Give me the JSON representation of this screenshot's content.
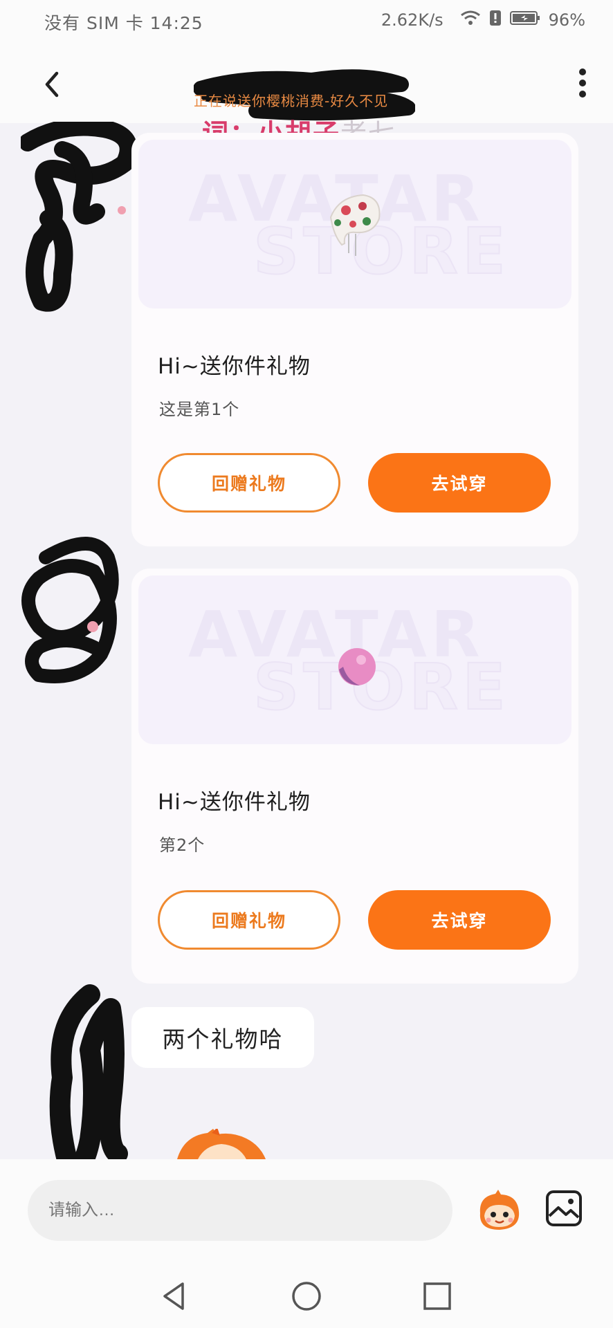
{
  "status_bar": {
    "carrier_time": "没有 SIM 卡 14:25",
    "speed": "2.62K/s",
    "battery": "96%"
  },
  "header": {
    "lyric_line": "正在说送你樱桃消费-好久不见",
    "lyric_credit": "词：小胡子",
    "lyric_credit_extra": "老七"
  },
  "cards": [
    {
      "watermark_1": "AVATAR",
      "watermark_2": "STORE",
      "title": "Hi~送你件礼物",
      "subtitle": "这是第1个",
      "return_gift_label": "回赠礼物",
      "try_on_label": "去试穿"
    },
    {
      "watermark_1": "AVATAR",
      "watermark_2": "STORE",
      "title": "Hi~送你件礼物",
      "subtitle": "第2个",
      "return_gift_label": "回赠礼物",
      "try_on_label": "去试穿"
    }
  ],
  "message": {
    "text": "两个礼物哈"
  },
  "input_bar": {
    "placeholder": "请输入…"
  },
  "colors": {
    "accent": "#fb7416",
    "lyric_orange": "#e98a43",
    "lyric_pink": "#d83c6b",
    "background": "#f3f2f7"
  },
  "icons": [
    "back-arrow-icon",
    "more-vertical-icon",
    "wifi-icon",
    "battery-icon",
    "mascot-emoji-icon",
    "image-gallery-icon",
    "nav-back-icon",
    "nav-home-icon",
    "nav-recents-icon"
  ]
}
